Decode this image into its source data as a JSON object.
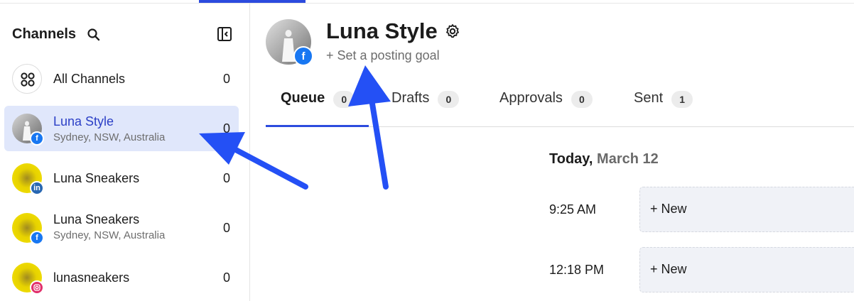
{
  "sidebar": {
    "title": "Channels",
    "channels": [
      {
        "name": "All Channels",
        "subtitle": "",
        "count": "0",
        "network": "all"
      },
      {
        "name": "Luna Style",
        "subtitle": "Sydney, NSW, Australia",
        "count": "0",
        "network": "facebook"
      },
      {
        "name": "Luna Sneakers",
        "subtitle": "",
        "count": "0",
        "network": "linkedin"
      },
      {
        "name": "Luna Sneakers",
        "subtitle": "Sydney, NSW, Australia",
        "count": "0",
        "network": "facebook"
      },
      {
        "name": "lunasneakers",
        "subtitle": "",
        "count": "0",
        "network": "instagram"
      }
    ]
  },
  "profile": {
    "name": "Luna Style",
    "goal_link": "+ Set a posting goal",
    "network": "facebook"
  },
  "tabs": [
    {
      "label": "Queue",
      "count": "0",
      "active": true
    },
    {
      "label": "Drafts",
      "count": "0",
      "active": false
    },
    {
      "label": "Approvals",
      "count": "0",
      "active": false
    },
    {
      "label": "Sent",
      "count": "1",
      "active": false
    }
  ],
  "queue": {
    "day_strong": "Today,",
    "day_date": "March 12",
    "slots": [
      {
        "time": "9:25 AM",
        "action": "+ New"
      },
      {
        "time": "12:18 PM",
        "action": "+ New"
      }
    ]
  },
  "colors": {
    "accent": "#2c4bde",
    "selected_bg": "#e0e7fb",
    "facebook": "#1877f2",
    "linkedin": "#2867b2",
    "instagram": "#e1306c",
    "annotation_arrow": "#2450f5"
  },
  "icons": {
    "search": "search-icon",
    "collapse": "sidebar-collapse-icon",
    "all_channels": "grid-icon",
    "settings": "gear-icon"
  }
}
